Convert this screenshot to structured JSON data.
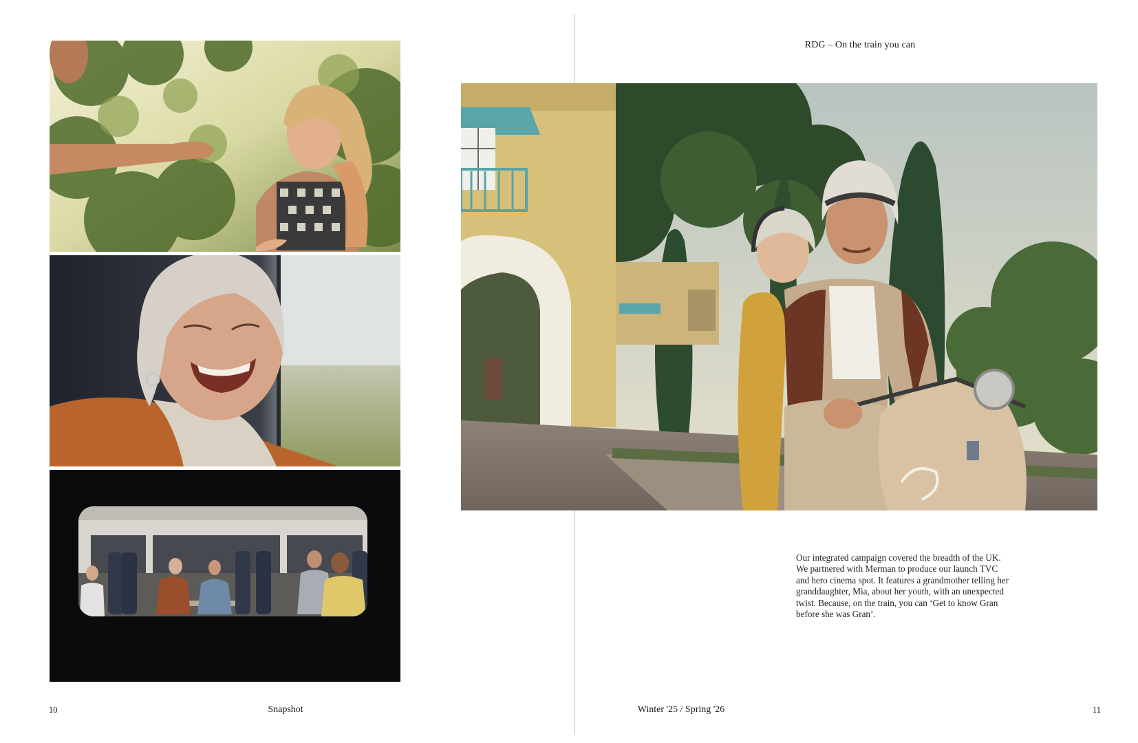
{
  "spread": {
    "left_page": {
      "page_number": "10",
      "publication": "Snapshot",
      "images": [
        {
          "name": "girl-in-garden-photo"
        },
        {
          "name": "grandmother-laughing-photo"
        },
        {
          "name": "train-carriage-photo"
        }
      ]
    },
    "right_page": {
      "page_number": "11",
      "issue": "Winter '25 / Spring '26",
      "header": "RDG – On the train you can",
      "hero_image": {
        "name": "couple-on-scooter-photo"
      },
      "body_lines": [
        "Our integrated campaign covered the breadth of the UK.",
        "We partnered with Merman to produce our launch TVC",
        "and hero cinema spot. It features a grandmother telling her",
        "granddaughter, Mia, about her youth, with an unexpected",
        "twist. Because, on the train, you can ‘Get to know Gran",
        "before she was Gran’."
      ]
    }
  },
  "colors": {
    "background": "#ffffff",
    "text": "#1a1a1a",
    "gutter": "#bdbdbd"
  }
}
